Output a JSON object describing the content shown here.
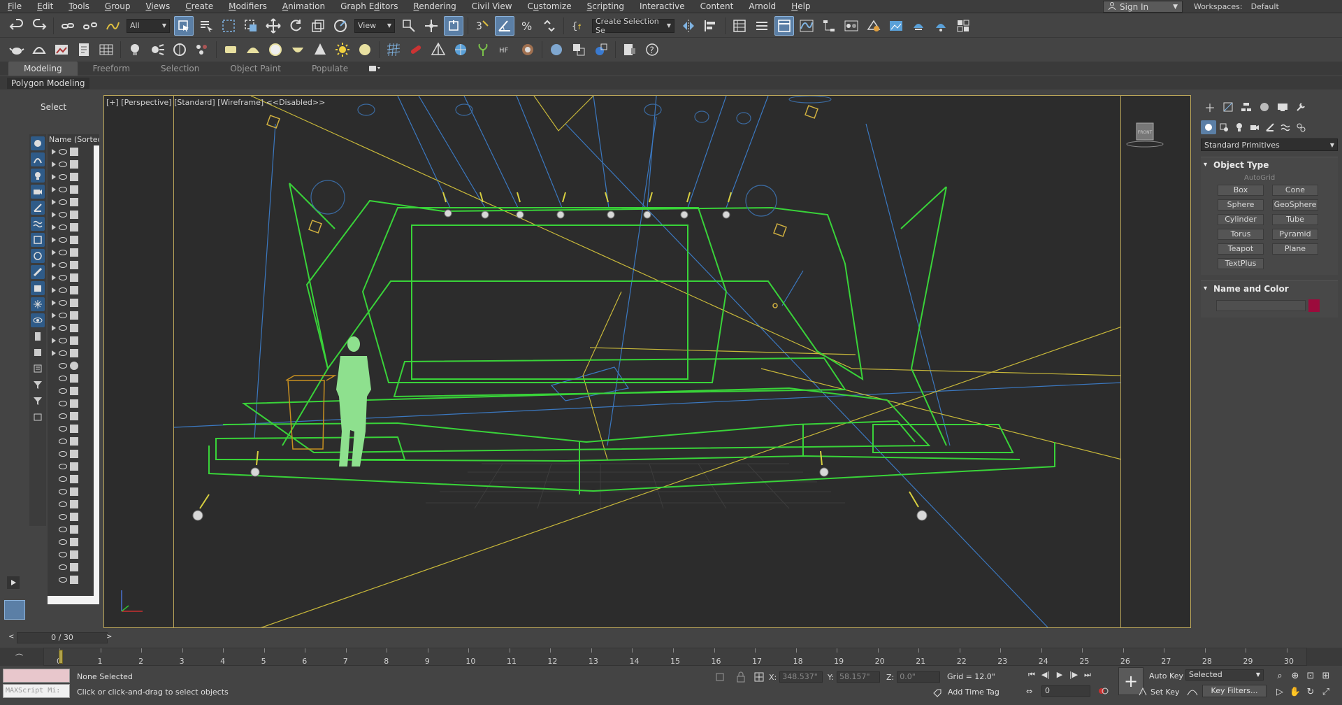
{
  "menubar": {
    "items": [
      {
        "pre": "",
        "u": "F",
        "post": "ile"
      },
      {
        "pre": "",
        "u": "E",
        "post": "dit"
      },
      {
        "pre": "",
        "u": "T",
        "post": "ools"
      },
      {
        "pre": "",
        "u": "G",
        "post": "roup"
      },
      {
        "pre": "",
        "u": "V",
        "post": "iews"
      },
      {
        "pre": "",
        "u": "C",
        "post": "reate"
      },
      {
        "pre": "",
        "u": "M",
        "post": "odifiers"
      },
      {
        "pre": "",
        "u": "A",
        "post": "nimation"
      },
      {
        "pre": "Graph E",
        "u": "d",
        "post": "itors"
      },
      {
        "pre": "",
        "u": "R",
        "post": "endering"
      },
      {
        "pre": "Civil View",
        "u": "",
        "post": ""
      },
      {
        "pre": "C",
        "u": "u",
        "post": "stomize"
      },
      {
        "pre": "",
        "u": "S",
        "post": "cripting"
      },
      {
        "pre": "Interactive",
        "u": "",
        "post": ""
      },
      {
        "pre": "Content",
        "u": "",
        "post": ""
      },
      {
        "pre": "Arnold",
        "u": "",
        "post": ""
      },
      {
        "pre": "",
        "u": "H",
        "post": "elp"
      }
    ],
    "sign_in": "Sign In",
    "workspaces_label": "Workspaces:",
    "workspaces_value": "Default"
  },
  "toolbar1": {
    "filter_dd": "All",
    "refcoord_dd": "View",
    "selection_set_dd": "Create Selection Se"
  },
  "ribbon": {
    "tabs": [
      "Modeling",
      "Freeform",
      "Selection",
      "Object Paint",
      "Populate"
    ],
    "active_tab": "Modeling",
    "panel_label": "Polygon Modeling"
  },
  "explorer": {
    "select_label": "Select",
    "column_header": "Name (Sorted A"
  },
  "viewport": {
    "label": "[+] [Perspective] [Standard] [Wireframe]  <<Disabled>>",
    "viewcube_label": "FRONT"
  },
  "command_panel": {
    "primitive_dd": "Standard Primitives",
    "object_type_title": "Object Type",
    "autogrid": "AutoGrid",
    "primitives": [
      "Box",
      "Cone",
      "Sphere",
      "GeoSphere",
      "Cylinder",
      "Tube",
      "Torus",
      "Pyramid",
      "Teapot",
      "Plane",
      "TextPlus"
    ],
    "name_color_title": "Name and Color",
    "object_color": "#9c0b3c"
  },
  "timeline": {
    "slider_label": "0 / 30",
    "ticks": [
      "0",
      "1",
      "2",
      "3",
      "4",
      "5",
      "6",
      "7",
      "8",
      "9",
      "10",
      "11",
      "12",
      "13",
      "14",
      "15",
      "16",
      "17",
      "18",
      "19",
      "20",
      "21",
      "22",
      "23",
      "24",
      "25",
      "26",
      "27",
      "28",
      "29",
      "30"
    ]
  },
  "status": {
    "maxscript_label": "MAXScript Mi:",
    "selection": "None Selected",
    "prompt": "Click or click-and-drag to select objects",
    "x_label": "X:",
    "x_value": "348.537\"",
    "y_label": "Y:",
    "y_value": "58.157\"",
    "z_label": "Z:",
    "z_value": "0.0\"",
    "grid": "Grid = 12.0\"",
    "add_time_tag": "Add Time Tag",
    "frame_value": "0",
    "auto_key": "Auto Key",
    "set_key": "Set Key",
    "selected_dd": "Selected",
    "key_filters": "Key Filters..."
  }
}
